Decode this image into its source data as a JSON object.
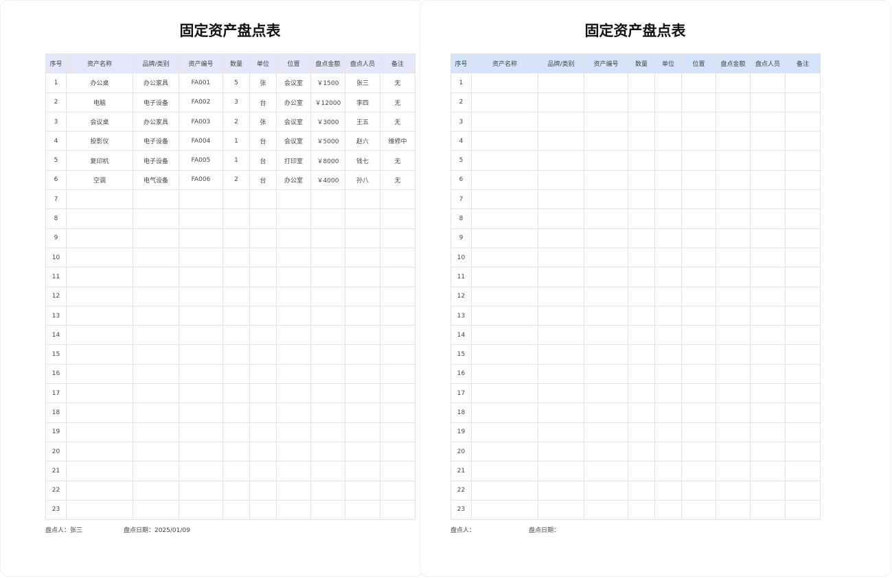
{
  "colors": {
    "header_left": "#e6e6fb",
    "header_right": "#d5e4fb",
    "grid": "#e3e3e6"
  },
  "columns": [
    "序号",
    "资产名称",
    "品牌/类别",
    "资产编号",
    "数量",
    "单位",
    "位置",
    "盘点金额",
    "盘点人员",
    "备注"
  ],
  "sheets": [
    {
      "title": "固定资产盘点表",
      "rows": [
        [
          "1",
          "办公桌",
          "办公家具",
          "FA001",
          "5",
          "张",
          "会议室",
          "￥1500",
          "张三",
          "无"
        ],
        [
          "2",
          "电脑",
          "电子设备",
          "FA002",
          "3",
          "台",
          "办公室",
          "￥12000",
          "李四",
          "无"
        ],
        [
          "3",
          "会议桌",
          "办公家具",
          "FA003",
          "2",
          "张",
          "会议室",
          "￥3000",
          "王五",
          "无"
        ],
        [
          "4",
          "投影仪",
          "电子设备",
          "FA004",
          "1",
          "台",
          "会议室",
          "￥5000",
          "赵六",
          "维修中"
        ],
        [
          "5",
          "复印机",
          "电子设备",
          "FA005",
          "1",
          "台",
          "打印室",
          "￥8000",
          "钱七",
          "无"
        ],
        [
          "6",
          "空调",
          "电气设备",
          "FA006",
          "2",
          "台",
          "办公室",
          "￥4000",
          "孙八",
          "无"
        ],
        [
          "7",
          "",
          "",
          "",
          "",
          "",
          "",
          "",
          "",
          ""
        ],
        [
          "8",
          "",
          "",
          "",
          "",
          "",
          "",
          "",
          "",
          ""
        ],
        [
          "9",
          "",
          "",
          "",
          "",
          "",
          "",
          "",
          "",
          ""
        ],
        [
          "10",
          "",
          "",
          "",
          "",
          "",
          "",
          "",
          "",
          ""
        ],
        [
          "11",
          "",
          "",
          "",
          "",
          "",
          "",
          "",
          "",
          ""
        ],
        [
          "12",
          "",
          "",
          "",
          "",
          "",
          "",
          "",
          "",
          ""
        ],
        [
          "13",
          "",
          "",
          "",
          "",
          "",
          "",
          "",
          "",
          ""
        ],
        [
          "14",
          "",
          "",
          "",
          "",
          "",
          "",
          "",
          "",
          ""
        ],
        [
          "15",
          "",
          "",
          "",
          "",
          "",
          "",
          "",
          "",
          ""
        ],
        [
          "16",
          "",
          "",
          "",
          "",
          "",
          "",
          "",
          "",
          ""
        ],
        [
          "17",
          "",
          "",
          "",
          "",
          "",
          "",
          "",
          "",
          ""
        ],
        [
          "18",
          "",
          "",
          "",
          "",
          "",
          "",
          "",
          "",
          ""
        ],
        [
          "19",
          "",
          "",
          "",
          "",
          "",
          "",
          "",
          "",
          ""
        ],
        [
          "20",
          "",
          "",
          "",
          "",
          "",
          "",
          "",
          "",
          ""
        ],
        [
          "21",
          "",
          "",
          "",
          "",
          "",
          "",
          "",
          "",
          ""
        ],
        [
          "22",
          "",
          "",
          "",
          "",
          "",
          "",
          "",
          "",
          ""
        ],
        [
          "23",
          "",
          "",
          "",
          "",
          "",
          "",
          "",
          "",
          ""
        ]
      ],
      "footer": {
        "person": "盘点人：张三",
        "date": "盘点日期：2025/01/09"
      }
    },
    {
      "title": "固定资产盘点表",
      "rows": [
        [
          "1",
          "",
          "",
          "",
          "",
          "",
          "",
          "",
          "",
          ""
        ],
        [
          "2",
          "",
          "",
          "",
          "",
          "",
          "",
          "",
          "",
          ""
        ],
        [
          "3",
          "",
          "",
          "",
          "",
          "",
          "",
          "",
          "",
          ""
        ],
        [
          "4",
          "",
          "",
          "",
          "",
          "",
          "",
          "",
          "",
          ""
        ],
        [
          "5",
          "",
          "",
          "",
          "",
          "",
          "",
          "",
          "",
          ""
        ],
        [
          "6",
          "",
          "",
          "",
          "",
          "",
          "",
          "",
          "",
          ""
        ],
        [
          "7",
          "",
          "",
          "",
          "",
          "",
          "",
          "",
          "",
          ""
        ],
        [
          "8",
          "",
          "",
          "",
          "",
          "",
          "",
          "",
          "",
          ""
        ],
        [
          "9",
          "",
          "",
          "",
          "",
          "",
          "",
          "",
          "",
          ""
        ],
        [
          "10",
          "",
          "",
          "",
          "",
          "",
          "",
          "",
          "",
          ""
        ],
        [
          "11",
          "",
          "",
          "",
          "",
          "",
          "",
          "",
          "",
          ""
        ],
        [
          "12",
          "",
          "",
          "",
          "",
          "",
          "",
          "",
          "",
          ""
        ],
        [
          "13",
          "",
          "",
          "",
          "",
          "",
          "",
          "",
          "",
          ""
        ],
        [
          "14",
          "",
          "",
          "",
          "",
          "",
          "",
          "",
          "",
          ""
        ],
        [
          "15",
          "",
          "",
          "",
          "",
          "",
          "",
          "",
          "",
          ""
        ],
        [
          "16",
          "",
          "",
          "",
          "",
          "",
          "",
          "",
          "",
          ""
        ],
        [
          "17",
          "",
          "",
          "",
          "",
          "",
          "",
          "",
          "",
          ""
        ],
        [
          "18",
          "",
          "",
          "",
          "",
          "",
          "",
          "",
          "",
          ""
        ],
        [
          "19",
          "",
          "",
          "",
          "",
          "",
          "",
          "",
          "",
          ""
        ],
        [
          "20",
          "",
          "",
          "",
          "",
          "",
          "",
          "",
          "",
          ""
        ],
        [
          "21",
          "",
          "",
          "",
          "",
          "",
          "",
          "",
          "",
          ""
        ],
        [
          "22",
          "",
          "",
          "",
          "",
          "",
          "",
          "",
          "",
          ""
        ],
        [
          "23",
          "",
          "",
          "",
          "",
          "",
          "",
          "",
          "",
          ""
        ]
      ],
      "footer": {
        "person": "盘点人：",
        "date": "盘点日期："
      }
    }
  ]
}
